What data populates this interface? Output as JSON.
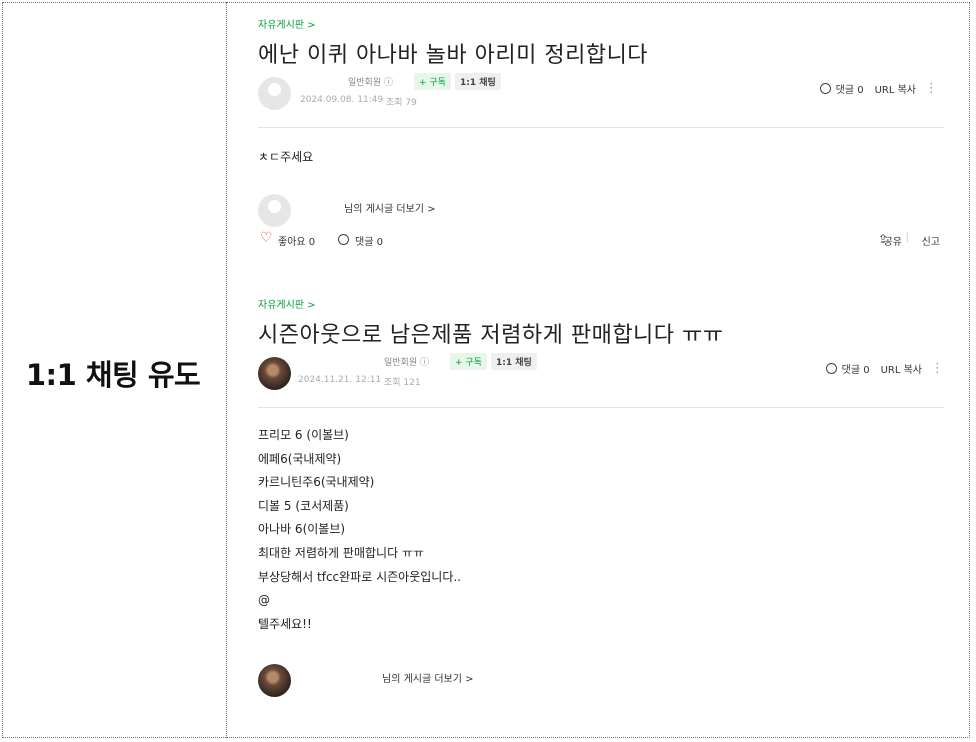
{
  "left_label": "1:1 채팅 유도",
  "posts": [
    {
      "board": "자유게시판 >",
      "title": "에난 이퀴 아나바 놀바 아리미 정리합니다",
      "role": "일반회원 ⓘ",
      "subscribe": "+ 구독",
      "chat": "1:1 채팅",
      "date": "2024.09.08. 11:49",
      "views": "조회 79",
      "comments": "댓글 0",
      "url_copy": "URL 복사",
      "more": "⋮",
      "body": [
        "ㅊㄷ주세요"
      ],
      "more_posts": "님의 게시글 더보기 >",
      "like": "좋아요 0",
      "comment_bottom": "댓글 0",
      "share": "공유",
      "report": "신고"
    },
    {
      "board": "자유게시판 >",
      "title": "시즌아웃으로 남은제품 저렴하게 판매합니다 ㅠㅠ",
      "role": "일반회원 ⓘ",
      "subscribe": "+ 구독",
      "chat": "1:1 채팅",
      "date": "2024.11.21. 12:11",
      "views": "조회 121",
      "comments": "댓글 0",
      "url_copy": "URL 복사",
      "more": "⋮",
      "body": [
        "프리모 6 (이볼브)",
        "에페6(국내제약)",
        "카르니틴주6(국내제약)",
        "디볼 5 (코서제품)",
        "아나바 6(이볼브)",
        "최대한 저렴하게 판매합니다 ㅠㅠ",
        "부상당해서 tfcc완파로 시즌아웃입니다..",
        "@",
        "텔주세요!!"
      ],
      "more_posts": "님의 게시글 더보기 >"
    }
  ]
}
